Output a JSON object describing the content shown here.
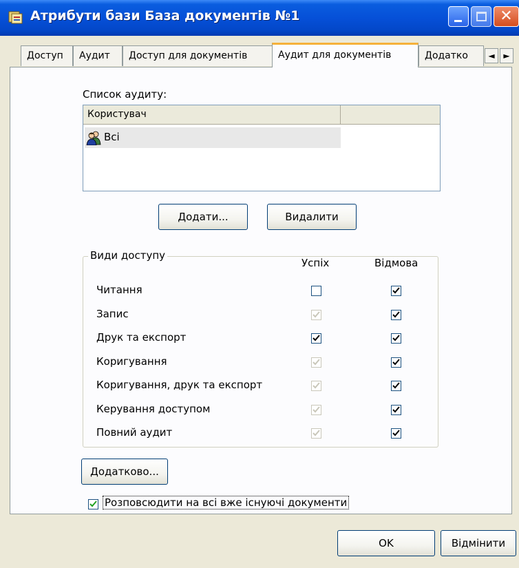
{
  "window": {
    "title": "Атрибути бази База документів №1",
    "close_glyph": "✕"
  },
  "tabs": [
    {
      "label": "Доступ",
      "active": false
    },
    {
      "label": "Аудит",
      "active": false
    },
    {
      "label": "Доступ для документів",
      "active": false
    },
    {
      "label": "Аудит для документів",
      "active": true
    },
    {
      "label": "Додатко",
      "active": false
    }
  ],
  "tab_scroll": {
    "left": "◄",
    "right": "►"
  },
  "audit_list": {
    "label": "Список аудиту:",
    "column_user": "Користувач",
    "column_extra": "",
    "rows": [
      {
        "name": "Всі",
        "icon": "users-group-icon"
      }
    ]
  },
  "buttons": {
    "add": "Додати...",
    "remove": "Видалити",
    "advanced": "Додатково...",
    "ok": "OK",
    "cancel": "Відмінити"
  },
  "access_types": {
    "title": "Види доступу",
    "col_success": "Успіх",
    "col_failure": "Відмова",
    "rows": [
      {
        "label": "Читання",
        "success": false,
        "success_disabled": false,
        "failure": true
      },
      {
        "label": "Запис",
        "success": true,
        "success_disabled": true,
        "failure": true
      },
      {
        "label": "Друк та експорт",
        "success": true,
        "success_disabled": false,
        "failure": true
      },
      {
        "label": "Коригування",
        "success": true,
        "success_disabled": true,
        "failure": true
      },
      {
        "label": "Коригування, друк та експорт",
        "success": true,
        "success_disabled": true,
        "failure": true
      },
      {
        "label": "Керування доступом",
        "success": true,
        "success_disabled": true,
        "failure": true
      },
      {
        "label": "Повний аудит",
        "success": true,
        "success_disabled": true,
        "failure": true
      }
    ]
  },
  "propagate": {
    "label": "Розповсюдити на всі вже існуючі документи",
    "checked": true
  },
  "colors": {
    "titlebar": "#0650d8",
    "face": "#ece9d8",
    "active_tab_accent": "#f6b13a"
  }
}
